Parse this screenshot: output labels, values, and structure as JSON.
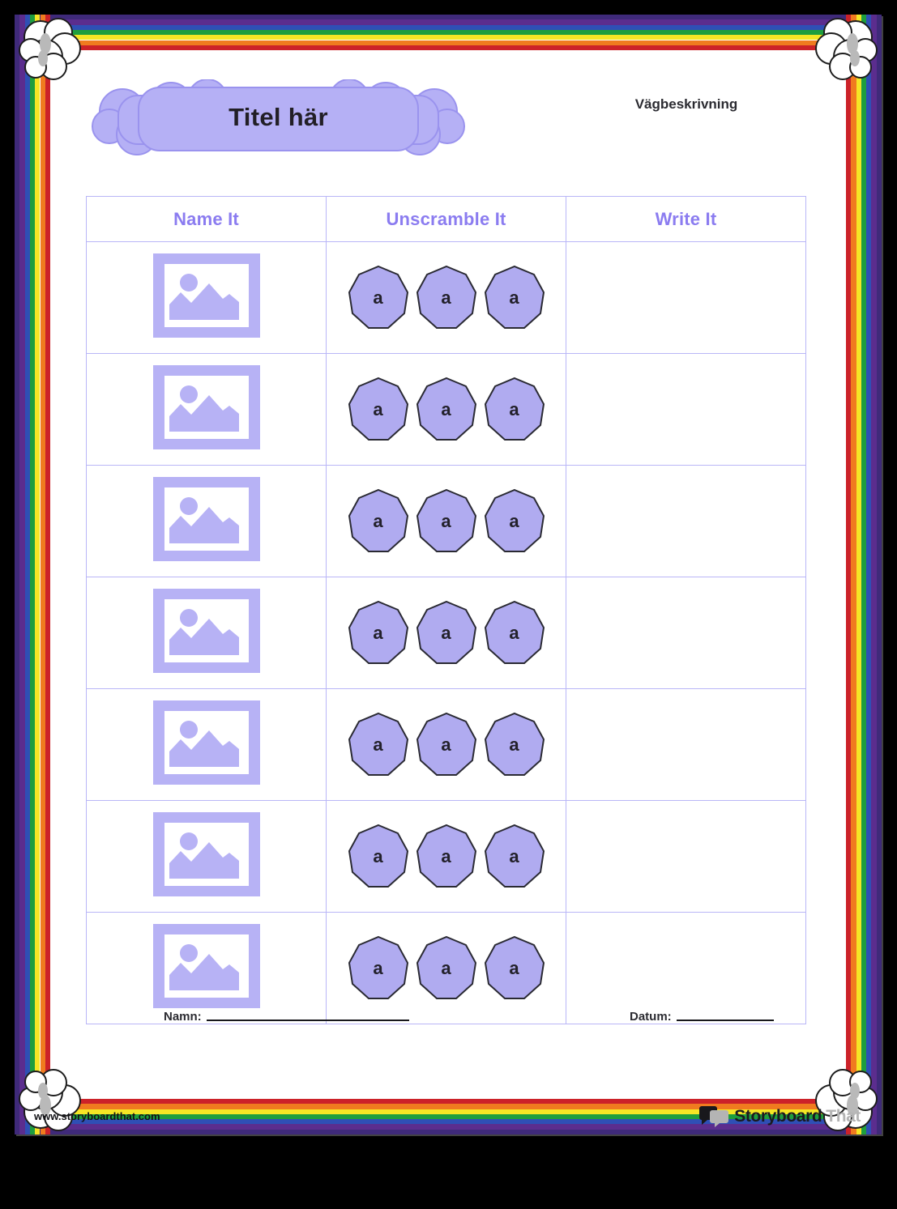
{
  "page": {
    "title": "Titel här",
    "directions_label": "Vägbeskrivning"
  },
  "table": {
    "columns": [
      {
        "label": "Name It"
      },
      {
        "label": "Unscramble It"
      },
      {
        "label": "Write It"
      }
    ],
    "rows": [
      {
        "image": "image-placeholder-icon",
        "tiles": [
          "a",
          "a",
          "a"
        ],
        "write_line": "handwriting-lines"
      },
      {
        "image": "image-placeholder-icon",
        "tiles": [
          "a",
          "a",
          "a"
        ],
        "write_line": "handwriting-lines"
      },
      {
        "image": "image-placeholder-icon",
        "tiles": [
          "a",
          "a",
          "a"
        ],
        "write_line": "handwriting-lines"
      },
      {
        "image": "image-placeholder-icon",
        "tiles": [
          "a",
          "a",
          "a"
        ],
        "write_line": "handwriting-lines"
      },
      {
        "image": "image-placeholder-icon",
        "tiles": [
          "a",
          "a",
          "a"
        ],
        "write_line": "handwriting-lines"
      },
      {
        "image": "image-placeholder-icon",
        "tiles": [
          "a",
          "a",
          "a"
        ],
        "write_line": "handwriting-lines"
      },
      {
        "image": "image-placeholder-icon",
        "tiles": [
          "a",
          "a",
          "a"
        ],
        "write_line": "handwriting-lines"
      }
    ]
  },
  "fields": {
    "name_label": "Namn:",
    "date_label": "Datum:"
  },
  "footer": {
    "url": "www.storyboardthat.com",
    "logo_primary": "Storyboard",
    "logo_secondary": "That"
  },
  "colors": {
    "accent_purple": "#8b7cf0",
    "tile_fill": "#b0abf0",
    "table_border": "#b9b6f7",
    "title_cloud_fill": "#b5b0f5",
    "rainbow": [
      "#3f2a7a",
      "#5b2d8e",
      "#2f4fb5",
      "#1e9e3e",
      "#f5e625",
      "#f07b1f",
      "#cc2229"
    ]
  }
}
